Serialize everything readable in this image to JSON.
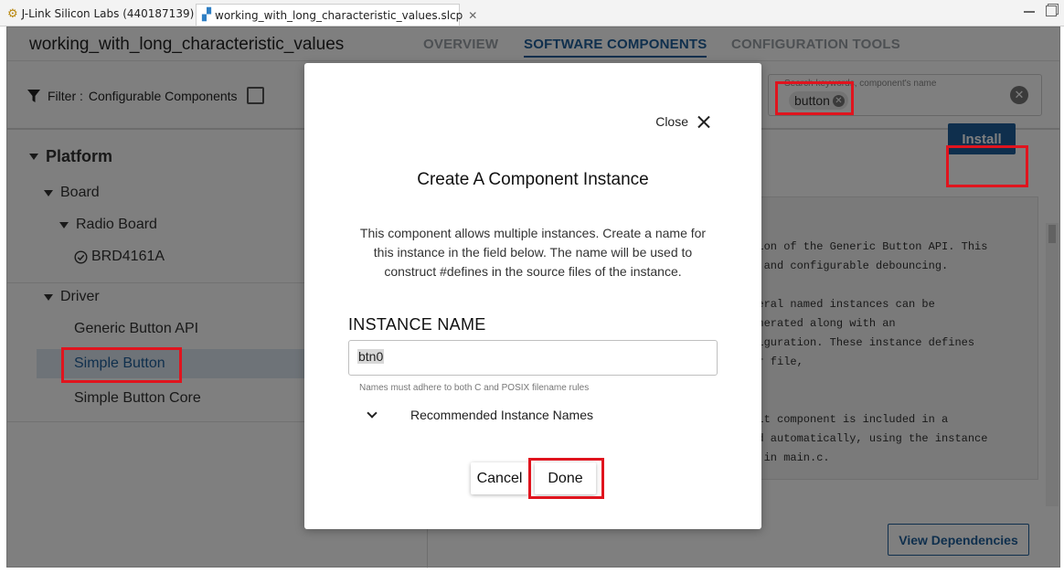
{
  "window_tabs": [
    {
      "label": "J-Link Silicon Labs (440187139)"
    },
    {
      "label": "working_with_long_characteristic_values.slcp"
    }
  ],
  "project": {
    "title": "working_with_long_characteristic_values"
  },
  "nav": {
    "overview": "OVERVIEW",
    "software_components": "SOFTWARE COMPONENTS",
    "configuration_tools": "CONFIGURATION TOOLS",
    "active": "SOFTWARE COMPONENTS"
  },
  "filter": {
    "label": "Filter :",
    "option": "Configurable Components",
    "checked": false
  },
  "search": {
    "placeholder": "Search keywords, component's name",
    "chip": "button"
  },
  "tree": {
    "platform": "Platform",
    "board": "Board",
    "radio_board": "Radio Board",
    "brd": "BRD4161A",
    "driver": "Driver",
    "generic_button_api": "Generic Button API",
    "simple_button": "Simple Button",
    "simple_button_core": "Simple Button Core"
  },
  "install_label": "Install",
  "view_dependencies_label": "View Dependencies",
  "description_lines": [
    "ation of the Generic Button API. This",
    "ns and configurable debouncing.",
    "",
    "everal named instances can be",
    "generated along with an",
    "nfiguration. These instance defines",
    "der file,",
    "",
    "",
    " Init component is included in a",
    "zed automatically, using the instance",
    "ll in main.c."
  ],
  "modal": {
    "close_label": "Close",
    "title": "Create A Component Instance",
    "description": "This component allows multiple instances. Create a name for this instance in the field below. The name will be used to construct #defines in the source files of the instance.",
    "instance_name_label": "INSTANCE NAME",
    "instance_name_value": "btn0",
    "hint": "Names must adhere to both C and POSIX filename rules",
    "recommended_label": "Recommended Instance Names",
    "cancel_label": "Cancel",
    "done_label": "Done"
  },
  "colors": {
    "accent": "#1f5f9a",
    "highlight": "#e0141e",
    "selected_row": "#dde7f1"
  }
}
